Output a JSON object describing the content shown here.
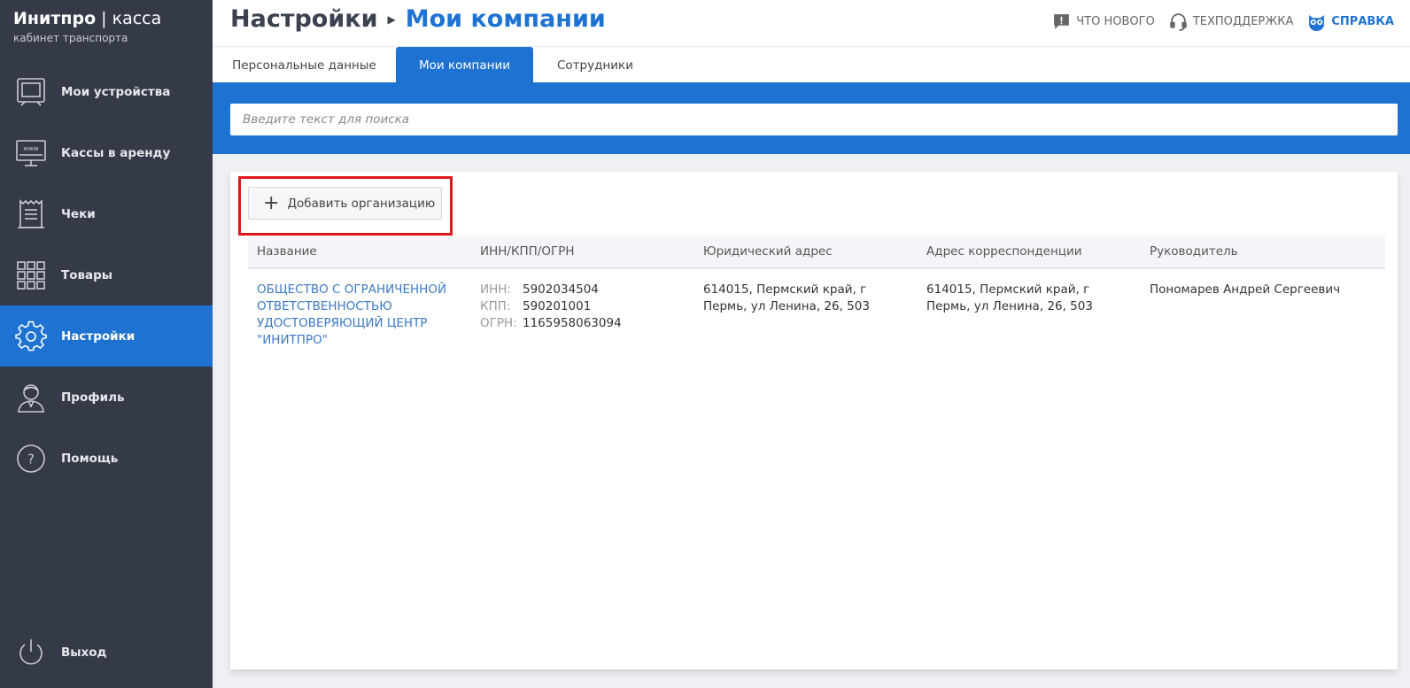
{
  "brand": {
    "name_bold": "Инитпро",
    "name_rest": " | касса",
    "subtitle": "кабинет транспорта"
  },
  "sidebar": {
    "items": [
      {
        "label": "Мои устройства",
        "icon": "device-icon"
      },
      {
        "label": "Кассы в аренду",
        "icon": "www-monitor-icon"
      },
      {
        "label": "Чеки",
        "icon": "receipt-icon"
      },
      {
        "label": "Товары",
        "icon": "grid-icon"
      },
      {
        "label": "Настройки",
        "icon": "gear-icon",
        "active": true
      },
      {
        "label": "Профиль",
        "icon": "user-icon"
      },
      {
        "label": "Помощь",
        "icon": "question-icon"
      }
    ],
    "logout": {
      "label": "Выход",
      "icon": "power-icon"
    }
  },
  "header": {
    "breadcrumb_parent": "Настройки",
    "breadcrumb_current": "Мои компании",
    "links": {
      "whats_new": "ЧТО НОВОГО",
      "support": "ТЕХПОДДЕРЖКА",
      "help": "СПРАВКА"
    }
  },
  "tabs": [
    {
      "label": "Персональные данные"
    },
    {
      "label": "Мои компании",
      "active": true
    },
    {
      "label": "Сотрудники"
    }
  ],
  "search": {
    "placeholder": "Введите текст для поиска"
  },
  "add_button": {
    "label": "Добавить организацию"
  },
  "table": {
    "columns": [
      "Название",
      "ИНН/КПП/ОГРН",
      "Юридический адрес",
      "Адрес корреспонденции",
      "Руководитель"
    ],
    "rows": [
      {
        "name": "ОБЩЕСТВО С ОГРАНИЧЕННОЙ ОТВЕТСТВЕННОСТЬЮ УДОСТОВЕРЯЮЩИЙ ЦЕНТР \"ИНИТПРО\"",
        "inn_label": "ИНН:",
        "inn": "5902034504",
        "kpp_label": "КПП:",
        "kpp": "590201001",
        "ogrn_label": "ОГРН:",
        "ogrn": "1165958063094",
        "legal_address": "614015, Пермский край, г Пермь, ул Ленина, 26, 503",
        "mail_address": "614015, Пермский край, г Пермь, ул Ленина, 26, 503",
        "director": "Пономарев Андрей Сергеевич"
      }
    ]
  },
  "colors": {
    "sidebar_bg": "#343a48",
    "accent": "#1e73d2",
    "highlight": "#e0161b",
    "link": "#3b79c4"
  }
}
